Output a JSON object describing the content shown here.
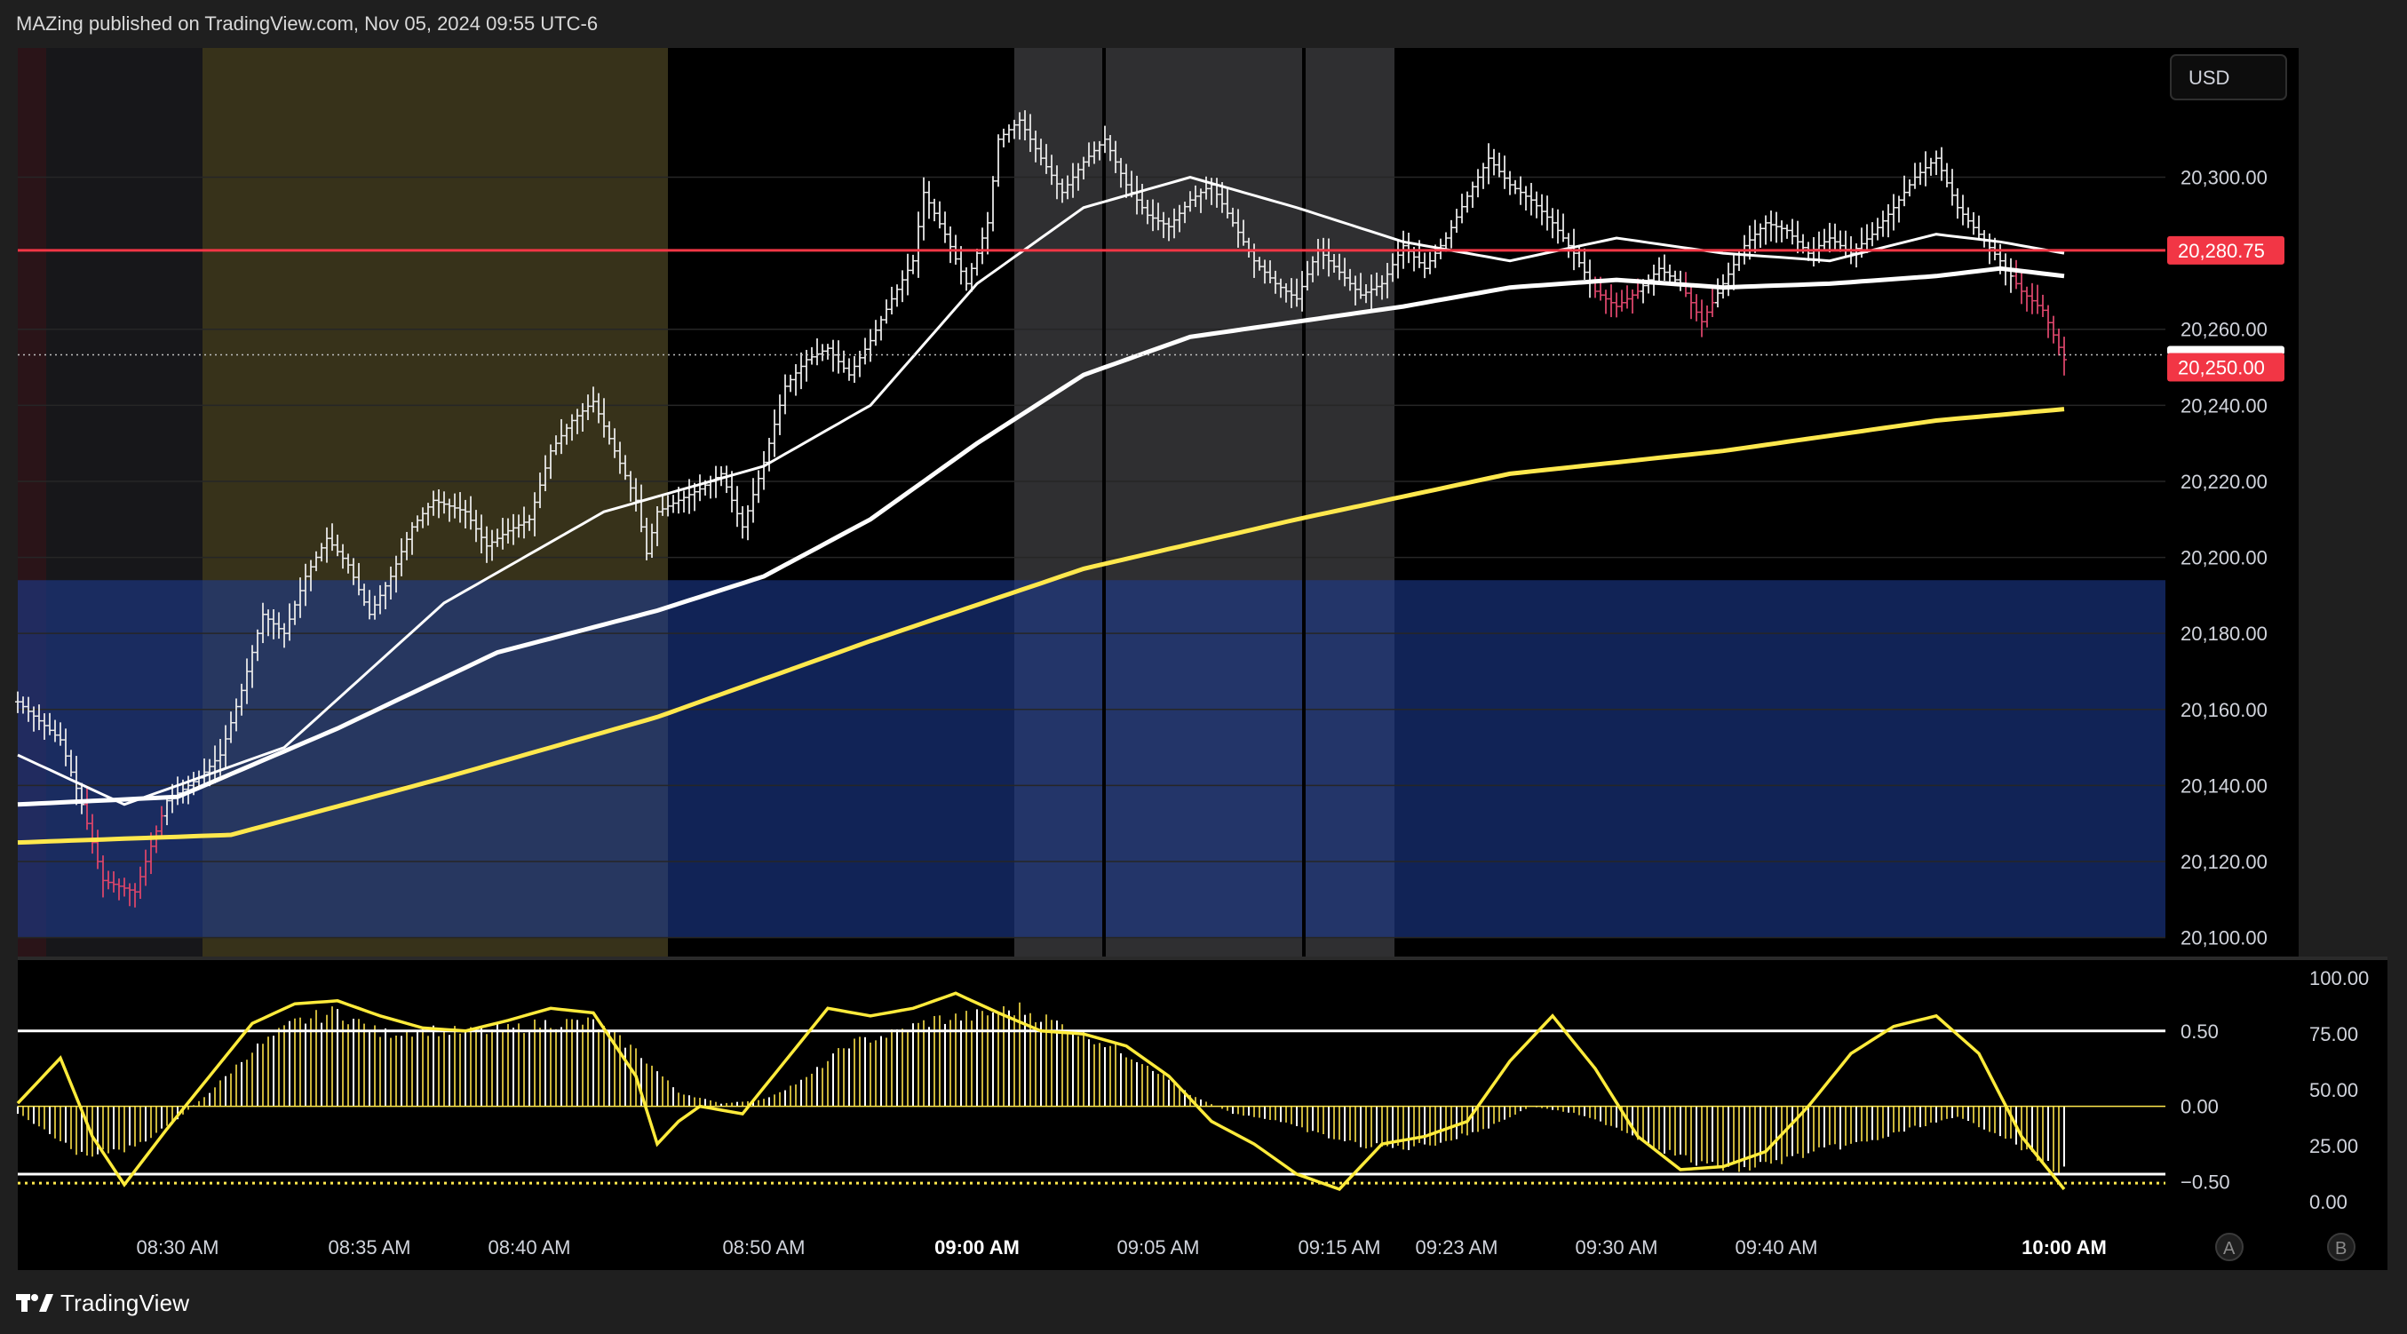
{
  "header": {
    "publisher_line": "MAZing published on TradingView.com, Nov 05, 2024 09:55 UTC-6"
  },
  "footer": {
    "brand": "TradingView"
  },
  "currency_button": "USD",
  "scale_buttons": [
    "A",
    "B"
  ],
  "colors": {
    "background": "#000000",
    "grid": "#2a2a2a",
    "red_level": "#f23645",
    "blue_zone": "#1c3b8f",
    "yellow_session": "#5a5416",
    "gray_session": "#3c3c3c",
    "dark_session": "#17171a",
    "ema_yellow": "#ffe84d",
    "ema_white": "#ffffff",
    "ema_blue": "#3d6cf0",
    "oscillator_line": "#ffeb3b"
  },
  "chart_data": [
    {
      "type": "candlestick",
      "y_axis_labels": [
        "20,300.00",
        "20,280.75",
        "20,260.00",
        "20,250.00",
        "20,240.00",
        "20,220.00",
        "20,200.00",
        "20,180.00",
        "20,160.00",
        "20,140.00",
        "20,120.00",
        "20,100.00"
      ],
      "y_ticks": [
        20300,
        20260,
        20240,
        20220,
        20200,
        20180,
        20160,
        20140,
        20120,
        20100
      ],
      "ylim": [
        20095,
        20334
      ],
      "x_labels": [
        "08:30 AM",
        "08:35 AM",
        "08:40 AM",
        "08:50 AM",
        "09:00 AM",
        "09:05 AM",
        "09:15 AM",
        "09:23 AM",
        "09:30 AM",
        "09:40 AM",
        "10:00 AM"
      ],
      "horizontal_level": {
        "value": 20280.75,
        "label": "20,280.75"
      },
      "last_price": {
        "value": 20250.0,
        "label": "20,250.00"
      },
      "blue_zone": [
        20100,
        20194
      ],
      "price_path": [
        [
          0,
          20162
        ],
        [
          4,
          20152
        ],
        [
          6,
          20135
        ],
        [
          8,
          20115
        ],
        [
          11,
          20112
        ],
        [
          14,
          20136
        ],
        [
          17,
          20142
        ],
        [
          19,
          20148
        ],
        [
          21,
          20165
        ],
        [
          23,
          20185
        ],
        [
          25,
          20180
        ],
        [
          27,
          20195
        ],
        [
          29,
          20205
        ],
        [
          31,
          20198
        ],
        [
          33,
          20185
        ],
        [
          35,
          20195
        ],
        [
          37,
          20208
        ],
        [
          39,
          20215
        ],
        [
          42,
          20212
        ],
        [
          44,
          20203
        ],
        [
          46,
          20207
        ],
        [
          48,
          20210
        ],
        [
          50,
          20228
        ],
        [
          52,
          20236
        ],
        [
          54,
          20241
        ],
        [
          56,
          20228
        ],
        [
          58,
          20215
        ],
        [
          59,
          20201
        ],
        [
          60,
          20212
        ],
        [
          62,
          20215
        ],
        [
          64,
          20218
        ],
        [
          66,
          20222
        ],
        [
          68,
          20208
        ],
        [
          70,
          20225
        ],
        [
          72,
          20245
        ],
        [
          74,
          20252
        ],
        [
          76,
          20255
        ],
        [
          78,
          20248
        ],
        [
          80,
          20257
        ],
        [
          82,
          20268
        ],
        [
          84,
          20278
        ],
        [
          85,
          20296
        ],
        [
          87,
          20285
        ],
        [
          89,
          20272
        ],
        [
          91,
          20288
        ],
        [
          92,
          20310
        ],
        [
          94,
          20315
        ],
        [
          96,
          20305
        ],
        [
          98,
          20296
        ],
        [
          100,
          20304
        ],
        [
          102,
          20310
        ],
        [
          104,
          20298
        ],
        [
          106,
          20290
        ],
        [
          108,
          20287
        ],
        [
          110,
          20294
        ],
        [
          112,
          20298
        ],
        [
          114,
          20288
        ],
        [
          116,
          20278
        ],
        [
          118,
          20272
        ],
        [
          120,
          20268
        ],
        [
          122,
          20281
        ],
        [
          124,
          20275
        ],
        [
          126,
          20269
        ],
        [
          128,
          20272
        ],
        [
          130,
          20282
        ],
        [
          132,
          20276
        ],
        [
          134,
          20284
        ],
        [
          136,
          20295
        ],
        [
          138,
          20305
        ],
        [
          140,
          20298
        ],
        [
          142,
          20294
        ],
        [
          144,
          20288
        ],
        [
          146,
          20280
        ],
        [
          148,
          20270
        ],
        [
          150,
          20266
        ],
        [
          152,
          20270
        ],
        [
          154,
          20276
        ],
        [
          156,
          20272
        ],
        [
          158,
          20262
        ],
        [
          160,
          20272
        ],
        [
          162,
          20282
        ],
        [
          164,
          20288
        ],
        [
          166,
          20286
        ],
        [
          168,
          20280
        ],
        [
          170,
          20284
        ],
        [
          172,
          20280
        ],
        [
          174,
          20285
        ],
        [
          176,
          20292
        ],
        [
          178,
          20300
        ],
        [
          180,
          20305
        ],
        [
          182,
          20292
        ],
        [
          184,
          20285
        ],
        [
          186,
          20278
        ],
        [
          188,
          20270
        ],
        [
          190,
          20265
        ],
        [
          192,
          20252
        ]
      ],
      "ema_fast_path": [
        [
          0,
          20148
        ],
        [
          10,
          20135
        ],
        [
          25,
          20150
        ],
        [
          40,
          20188
        ],
        [
          55,
          20212
        ],
        [
          70,
          20224
        ],
        [
          80,
          20240
        ],
        [
          90,
          20272
        ],
        [
          100,
          20292
        ],
        [
          110,
          20300
        ],
        [
          120,
          20292
        ],
        [
          130,
          20283
        ],
        [
          140,
          20278
        ],
        [
          150,
          20284
        ],
        [
          160,
          20280
        ],
        [
          170,
          20278
        ],
        [
          180,
          20285
        ],
        [
          186,
          20283
        ],
        [
          192,
          20280
        ]
      ],
      "ema_mid_path": [
        [
          0,
          20135
        ],
        [
          15,
          20137
        ],
        [
          30,
          20155
        ],
        [
          45,
          20175
        ],
        [
          60,
          20186
        ],
        [
          70,
          20195
        ],
        [
          80,
          20210
        ],
        [
          90,
          20230
        ],
        [
          100,
          20248
        ],
        [
          110,
          20258
        ],
        [
          120,
          20262
        ],
        [
          130,
          20266
        ],
        [
          140,
          20271
        ],
        [
          150,
          20273
        ],
        [
          160,
          20271
        ],
        [
          170,
          20272
        ],
        [
          180,
          20274
        ],
        [
          186,
          20276
        ],
        [
          192,
          20274
        ]
      ],
      "ema_slow_path": [
        [
          0,
          20125
        ],
        [
          20,
          20127
        ],
        [
          40,
          20142
        ],
        [
          60,
          20158
        ],
        [
          80,
          20178
        ],
        [
          100,
          20197
        ],
        [
          120,
          20210
        ],
        [
          140,
          20222
        ],
        [
          160,
          20228
        ],
        [
          180,
          20236
        ],
        [
          192,
          20239
        ]
      ]
    },
    {
      "type": "bar",
      "name": "oscillator",
      "left_axis_labels": [
        "0.50",
        "0.00",
        "−0.50"
      ],
      "right_axis_labels": [
        "100.00",
        "75.00",
        "50.00",
        "25.00",
        "0.00"
      ],
      "ylim": [
        -0.78,
        0.97
      ],
      "reference_levels": [
        0.5,
        -0.45
      ],
      "dotted_level": -0.51,
      "histogram_envelope": [
        [
          0,
          -0.05
        ],
        [
          6,
          -0.35
        ],
        [
          10,
          -0.32
        ],
        [
          14,
          -0.15
        ],
        [
          18,
          0.1
        ],
        [
          22,
          0.4
        ],
        [
          26,
          0.6
        ],
        [
          30,
          0.68
        ],
        [
          34,
          0.52
        ],
        [
          38,
          0.55
        ],
        [
          42,
          0.53
        ],
        [
          46,
          0.55
        ],
        [
          50,
          0.6
        ],
        [
          54,
          0.6
        ],
        [
          58,
          0.4
        ],
        [
          62,
          0.1
        ],
        [
          66,
          0.02
        ],
        [
          70,
          0.05
        ],
        [
          74,
          0.2
        ],
        [
          78,
          0.45
        ],
        [
          82,
          0.52
        ],
        [
          86,
          0.62
        ],
        [
          90,
          0.65
        ],
        [
          94,
          0.7
        ],
        [
          98,
          0.58
        ],
        [
          102,
          0.45
        ],
        [
          106,
          0.3
        ],
        [
          110,
          0.08
        ],
        [
          114,
          -0.05
        ],
        [
          118,
          -0.1
        ],
        [
          122,
          -0.2
        ],
        [
          126,
          -0.28
        ],
        [
          130,
          -0.3
        ],
        [
          134,
          -0.25
        ],
        [
          138,
          -0.15
        ],
        [
          142,
          0.0
        ],
        [
          146,
          -0.05
        ],
        [
          150,
          -0.15
        ],
        [
          154,
          -0.3
        ],
        [
          158,
          -0.42
        ],
        [
          162,
          -0.45
        ],
        [
          166,
          -0.38
        ],
        [
          170,
          -0.3
        ],
        [
          174,
          -0.25
        ],
        [
          178,
          -0.15
        ],
        [
          182,
          -0.08
        ],
        [
          186,
          -0.2
        ],
        [
          190,
          -0.4
        ],
        [
          192,
          -0.47
        ]
      ],
      "signal_line": [
        [
          0,
          0.02
        ],
        [
          4,
          0.32
        ],
        [
          7,
          -0.2
        ],
        [
          10,
          -0.52
        ],
        [
          14,
          -0.15
        ],
        [
          18,
          0.2
        ],
        [
          22,
          0.55
        ],
        [
          26,
          0.68
        ],
        [
          30,
          0.7
        ],
        [
          34,
          0.6
        ],
        [
          38,
          0.52
        ],
        [
          42,
          0.5
        ],
        [
          46,
          0.57
        ],
        [
          50,
          0.65
        ],
        [
          54,
          0.62
        ],
        [
          58,
          0.2
        ],
        [
          60,
          -0.25
        ],
        [
          62,
          -0.1
        ],
        [
          64,
          0.0
        ],
        [
          68,
          -0.05
        ],
        [
          72,
          0.3
        ],
        [
          76,
          0.65
        ],
        [
          80,
          0.6
        ],
        [
          84,
          0.65
        ],
        [
          88,
          0.75
        ],
        [
          92,
          0.62
        ],
        [
          96,
          0.5
        ],
        [
          100,
          0.48
        ],
        [
          104,
          0.4
        ],
        [
          108,
          0.2
        ],
        [
          112,
          -0.1
        ],
        [
          116,
          -0.25
        ],
        [
          120,
          -0.45
        ],
        [
          124,
          -0.55
        ],
        [
          128,
          -0.25
        ],
        [
          132,
          -0.2
        ],
        [
          136,
          -0.1
        ],
        [
          140,
          0.3
        ],
        [
          144,
          0.6
        ],
        [
          148,
          0.25
        ],
        [
          152,
          -0.2
        ],
        [
          156,
          -0.42
        ],
        [
          160,
          -0.4
        ],
        [
          164,
          -0.3
        ],
        [
          168,
          0.0
        ],
        [
          172,
          0.35
        ],
        [
          176,
          0.53
        ],
        [
          180,
          0.6
        ],
        [
          184,
          0.35
        ],
        [
          188,
          -0.2
        ],
        [
          192,
          -0.55
        ]
      ]
    }
  ]
}
